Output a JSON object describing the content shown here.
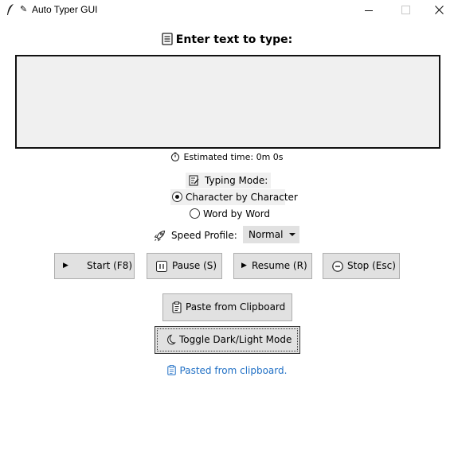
{
  "window": {
    "title": "Auto Typer GUI",
    "title_glyph": "✎"
  },
  "heading": {
    "icon": "document-icon",
    "text": "Enter text to type:"
  },
  "text_input": {
    "value": ""
  },
  "estimate": {
    "icon": "stopwatch-icon",
    "text": "Estimated time: 0m 0s"
  },
  "typing_mode": {
    "icon": "memo-icon",
    "label": "Typing Mode:",
    "options": [
      {
        "label": "Character by Character",
        "selected": true
      },
      {
        "label": "Word by Word",
        "selected": false
      }
    ]
  },
  "speed_profile": {
    "icon": "rocket-icon",
    "label": "Speed Profile:",
    "selected": "Normal"
  },
  "controls": {
    "start": {
      "glyph": "▶",
      "label": "Start (F8)"
    },
    "pause": {
      "label": "Pause (S)"
    },
    "resume": {
      "glyph": "▶",
      "label": "Resume (R)"
    },
    "stop": {
      "label": "Stop (Esc)"
    }
  },
  "paste_button": {
    "icon": "clipboard-icon",
    "label": "Paste from Clipboard"
  },
  "toggle_button": {
    "icon": "moon-icon",
    "label": "Toggle Dark/Light Mode"
  },
  "status": {
    "icon": "clipboard-icon",
    "text": "Pasted from clipboard.",
    "color": "#1f6fc5"
  }
}
